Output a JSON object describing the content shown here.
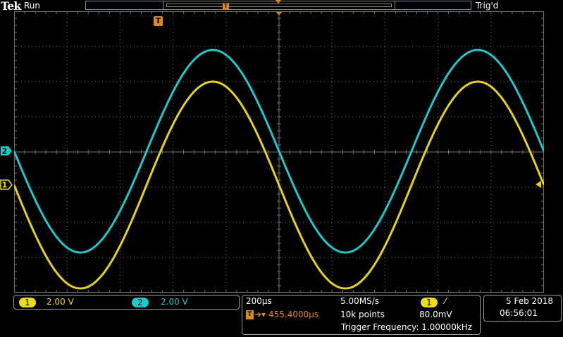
{
  "header": {
    "brand": "Tek",
    "run_state": "Run",
    "trigger_state": "Trig'd",
    "trigger_marker": "T"
  },
  "channels": {
    "ch1": {
      "number": "1",
      "scale": "2.00 V",
      "color": "#ecdc1e"
    },
    "ch2": {
      "number": "2",
      "scale": "2.00 V",
      "color": "#1ec9cc"
    }
  },
  "acquisition": {
    "time_per_div": "200µs",
    "sample_rate": "5.00MS/s",
    "trigger_icon": "T",
    "arrow": "➔▾",
    "trigger_delay": "455.4000µs",
    "record_length": "10k points",
    "trigger_source": "1",
    "trigger_slope": "⁄",
    "trigger_level": "80.0mV",
    "trigger_frequency": "Trigger Frequency: 1.00000kHz"
  },
  "datetime": {
    "date": "5 Feb  2018",
    "time": "06:56:01"
  },
  "colors": {
    "trigger_orange": "#e08a1e",
    "graticule": "#707070",
    "background": "#000000"
  }
}
